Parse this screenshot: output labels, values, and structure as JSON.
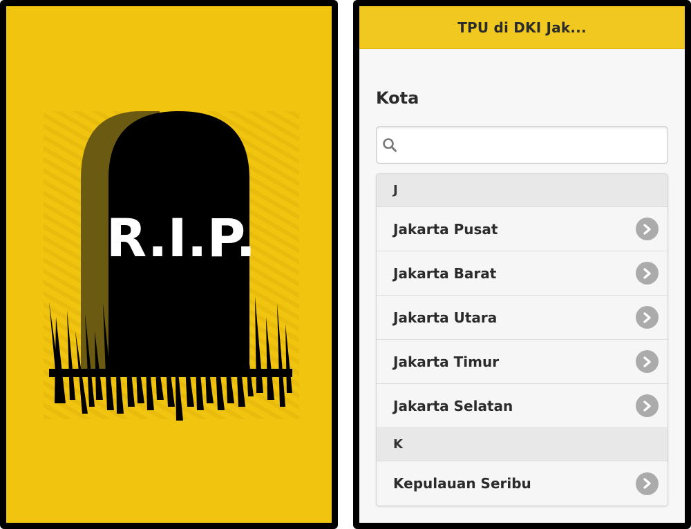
{
  "splash": {
    "tombstone_text": "R.I.P.",
    "colors": {
      "background": "#f1c40f",
      "stone": "#000000",
      "shadow": "#6b5a12"
    }
  },
  "app": {
    "header_title": "TPU di DKI Jak...",
    "section_title": "Kota",
    "search": {
      "placeholder": "",
      "value": ""
    },
    "groups": [
      {
        "letter": "J",
        "items": [
          {
            "label": "Jakarta Pusat"
          },
          {
            "label": "Jakarta Barat"
          },
          {
            "label": "Jakarta Utara"
          },
          {
            "label": "Jakarta Timur"
          },
          {
            "label": "Jakarta Selatan"
          }
        ]
      },
      {
        "letter": "K",
        "items": [
          {
            "label": "Kepulauan Seribu"
          }
        ]
      }
    ],
    "icons": {
      "search": "search-icon",
      "item_arrow": "chevron-right-icon"
    },
    "colors": {
      "header": "#f1c81f",
      "chevron_bg": "#ababab"
    }
  }
}
